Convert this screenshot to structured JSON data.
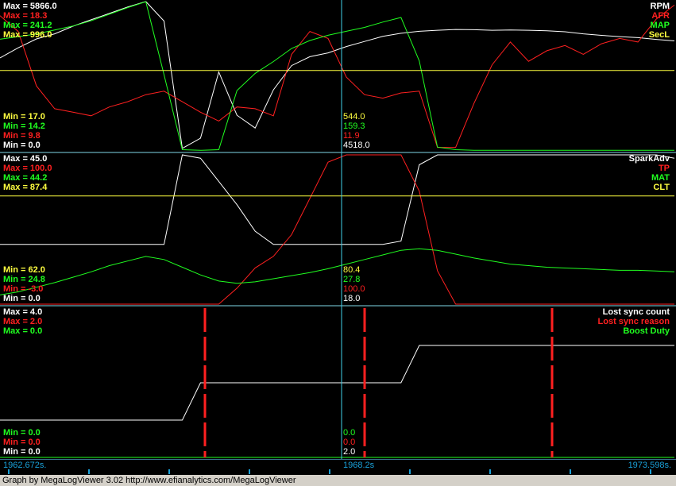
{
  "chart_data": [
    {
      "type": "line",
      "panel": 1,
      "series": [
        {
          "name": "RPM",
          "color": "#ffffff",
          "min": "0.0",
          "max": "5866.0",
          "cursor": "4518.0",
          "y": [
            3650,
            4050,
            4400,
            4600,
            4900,
            5150,
            5400,
            5650,
            5866,
            5100,
            100,
            500,
            3100,
            1400,
            900,
            2400,
            3350,
            3700,
            3850,
            4100,
            4300,
            4500,
            4620,
            4700,
            4740,
            4770,
            4760,
            4740,
            4750,
            4740,
            4720,
            4680,
            4600,
            4540,
            4490,
            4450,
            4380,
            4320
          ]
        },
        {
          "name": "AFR",
          "color": "#ff2020",
          "min": "9.8",
          "max": "18.3",
          "cursor": "11.9",
          "y": [
            17.5,
            16.6,
            13.5,
            12.2,
            12.0,
            11.8,
            12.3,
            12.6,
            13.0,
            13.2,
            12.6,
            12.0,
            11.5,
            12.3,
            12.2,
            11.8,
            15.3,
            16.6,
            16.2,
            14.0,
            13.0,
            12.8,
            13.1,
            13.2,
            10.0,
            10.0,
            12.5,
            14.7,
            16.0,
            14.9,
            15.5,
            15.8,
            15.3,
            15.9,
            16.2,
            16.0,
            17.3,
            18.1
          ]
        },
        {
          "name": "MAP",
          "color": "#20ff20",
          "min": "14.2",
          "max": "241.2",
          "cursor": "159.3",
          "y": [
            184,
            188,
            192,
            198,
            204,
            212,
            222,
            232,
            241,
            130,
            16,
            15,
            16,
            106,
            132,
            150,
            170,
            182,
            190,
            196,
            202,
            210,
            217,
            151,
            20,
            16,
            15,
            15,
            15,
            15,
            15,
            15,
            15,
            15,
            15,
            15,
            15,
            15
          ]
        },
        {
          "name": "SecL",
          "color": "#ffff40",
          "min": "17.0",
          "max": "996.0",
          "cursor": "544.0",
          "y": [
            544,
            544,
            544,
            544,
            544,
            544,
            544,
            544,
            544,
            544,
            544,
            544,
            544,
            544,
            544,
            544,
            544,
            544,
            544,
            544,
            544,
            544,
            544,
            544,
            544,
            544,
            544,
            544,
            544,
            544,
            544,
            544,
            544,
            544,
            544,
            544,
            544,
            544
          ]
        }
      ]
    },
    {
      "type": "line",
      "panel": 2,
      "series": [
        {
          "name": "SparkAdv",
          "color": "#ffffff",
          "min": "0.0",
          "max": "45.0",
          "cursor": "18.0",
          "y": [
            18,
            18,
            18,
            18,
            18,
            18,
            18,
            18,
            18,
            18,
            45,
            44,
            37,
            30,
            22,
            18,
            18,
            18,
            18,
            18,
            18,
            18,
            19,
            42,
            45,
            45,
            45,
            45,
            45,
            45,
            45,
            45,
            45,
            45,
            45,
            45,
            45,
            44
          ]
        },
        {
          "name": "TP",
          "color": "#ff2020",
          "min": "-3.0",
          "max": "100.0",
          "cursor": "100.0",
          "y": [
            -3,
            -3,
            -3,
            -3,
            -3,
            -3,
            -3,
            -3,
            -3,
            -3,
            -3,
            -3,
            -3,
            8,
            22,
            30,
            45,
            70,
            95,
            100,
            100,
            100,
            100,
            75,
            20,
            -3,
            -3,
            -3,
            -3,
            -3,
            -3,
            -3,
            -3,
            -3,
            -3,
            -3,
            -3,
            -3
          ]
        },
        {
          "name": "MAT",
          "color": "#20ff20",
          "min": "24.8",
          "max": "44.2",
          "cursor": "27.8",
          "y": [
            26.0,
            26.4,
            27.0,
            27.6,
            28.3,
            29.0,
            29.8,
            30.4,
            31.0,
            30.6,
            29.6,
            28.6,
            27.8,
            27.5,
            27.7,
            28.1,
            28.5,
            28.9,
            29.4,
            30.0,
            30.6,
            31.2,
            31.8,
            32.0,
            31.8,
            31.3,
            30.8,
            30.4,
            30.0,
            29.8,
            29.6,
            29.5,
            29.4,
            29.3,
            29.2,
            29.2,
            29.1,
            29.0
          ]
        },
        {
          "name": "CLT",
          "color": "#ffff40",
          "min": "62.0",
          "max": "87.4",
          "cursor": "80.4",
          "y": [
            80.4,
            80.4,
            80.4,
            80.4,
            80.4,
            80.4,
            80.4,
            80.4,
            80.4,
            80.4,
            80.4,
            80.4,
            80.4,
            80.4,
            80.4,
            80.4,
            80.4,
            80.4,
            80.4,
            80.4,
            80.4,
            80.4,
            80.4,
            80.4,
            80.4,
            80.4,
            80.4,
            80.4,
            80.4,
            80.4,
            80.4,
            80.4,
            80.4,
            80.4,
            80.4,
            80.4,
            80.4,
            80.4
          ]
        }
      ]
    },
    {
      "type": "line",
      "panel": 3,
      "series": [
        {
          "name": "Lost sync count",
          "color": "#ffffff",
          "min": "0.0",
          "max": "4.0",
          "cursor": "2.0",
          "y": [
            1,
            1,
            1,
            1,
            1,
            1,
            1,
            1,
            1,
            1,
            1,
            2,
            2,
            2,
            2,
            2,
            2,
            2,
            2,
            2,
            2,
            2,
            2,
            3,
            3,
            3,
            3,
            3,
            3,
            3,
            3,
            3,
            3,
            3,
            3,
            3,
            3,
            3
          ]
        },
        {
          "name": "Lost sync reason",
          "color": "#ff2020",
          "min": "0.0",
          "max": "2.0",
          "cursor": "0.0",
          "y": [
            0,
            0,
            0,
            0,
            0,
            0,
            0,
            0,
            0,
            0,
            0,
            0,
            0,
            0,
            0,
            0,
            0,
            0,
            0,
            0,
            0,
            0,
            0,
            0,
            0,
            0,
            0,
            0,
            0,
            0,
            0,
            0,
            0,
            0,
            0,
            0,
            0,
            0
          ]
        },
        {
          "name": "Boost Duty",
          "color": "#20ff20",
          "min": "0.0",
          "max": "0.0",
          "cursor": "0.0",
          "y": [
            0,
            0,
            0,
            0,
            0,
            0,
            0,
            0,
            0,
            0,
            0,
            0,
            0,
            0,
            0,
            0,
            0,
            0,
            0,
            0,
            0,
            0,
            0,
            0,
            0,
            0,
            0,
            0,
            0,
            0,
            0,
            0,
            0,
            0,
            0,
            0,
            0,
            0
          ]
        }
      ]
    }
  ],
  "x_axis": {
    "start": "1962.672s.",
    "cursor": "1968.2s",
    "end": "1973.598s."
  },
  "footer": "Graph by MegaLogViewer 3.02 http://www.efianalytics.com/MegaLogViewer",
  "labels": {
    "max_prefix": "Max = ",
    "min_prefix": "Min = "
  }
}
